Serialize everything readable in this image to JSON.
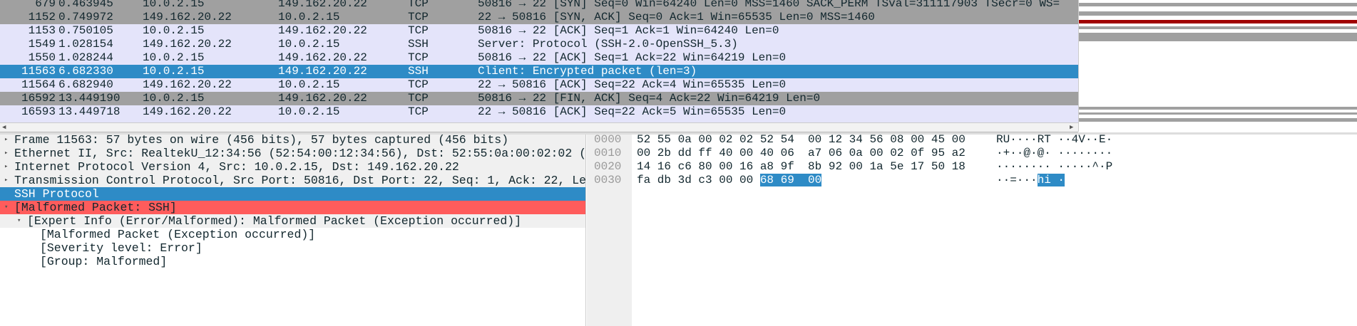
{
  "packets": [
    {
      "no": "679",
      "time": "0.463945",
      "src": "10.0.2.15",
      "dst": "149.162.20.22",
      "proto": "TCP",
      "info": "50816 → 22 [SYN] Seq=0 Win=64240 Len=0 MSS=1460 SACK_PERM TSval=311117903 TSecr=0 WS=",
      "style": "gray"
    },
    {
      "no": "1152",
      "time": "0.749972",
      "src": "149.162.20.22",
      "dst": "10.0.2.15",
      "proto": "TCP",
      "info": "22 → 50816 [SYN, ACK] Seq=0 Ack=1 Win=65535 Len=0 MSS=1460",
      "style": "gray"
    },
    {
      "no": "1153",
      "time": "0.750105",
      "src": "10.0.2.15",
      "dst": "149.162.20.22",
      "proto": "TCP",
      "info": "50816 → 22 [ACK] Seq=1 Ack=1 Win=64240 Len=0",
      "style": "lav"
    },
    {
      "no": "1549",
      "time": "1.028154",
      "src": "149.162.20.22",
      "dst": "10.0.2.15",
      "proto": "SSH",
      "info": "Server: Protocol (SSH-2.0-OpenSSH_5.3)",
      "style": "lav"
    },
    {
      "no": "1550",
      "time": "1.028244",
      "src": "10.0.2.15",
      "dst": "149.162.20.22",
      "proto": "TCP",
      "info": "50816 → 22 [ACK] Seq=1 Ack=22 Win=64219 Len=0",
      "style": "lav"
    },
    {
      "no": "11563",
      "time": "6.682330",
      "src": "10.0.2.15",
      "dst": "149.162.20.22",
      "proto": "SSH",
      "info": "Client: Encrypted packet (len=3)",
      "style": "sel"
    },
    {
      "no": "11564",
      "time": "6.682940",
      "src": "149.162.20.22",
      "dst": "10.0.2.15",
      "proto": "TCP",
      "info": "22 → 50816 [ACK] Seq=22 Ack=4 Win=65535 Len=0",
      "style": "lav"
    },
    {
      "no": "16592",
      "time": "13.449190",
      "src": "10.0.2.15",
      "dst": "149.162.20.22",
      "proto": "TCP",
      "info": "50816 → 22 [FIN, ACK] Seq=4 Ack=22 Win=64219 Len=0",
      "style": "gray"
    },
    {
      "no": "16593",
      "time": "13.449718",
      "src": "149.162.20.22",
      "dst": "10.0.2.15",
      "proto": "TCP",
      "info": "22 → 50816 [ACK] Seq=22 Ack=5 Win=65535 Len=0",
      "style": "lav"
    }
  ],
  "details": [
    {
      "text": "Frame 11563: 57 bytes on wire (456 bits), 57 bytes captured (456 bits)",
      "indent": 0,
      "twisty": "▸",
      "style": "lg"
    },
    {
      "text": "Ethernet II, Src: RealtekU_12:34:56 (52:54:00:12:34:56), Dst: 52:55:0a:00:02:02 (",
      "indent": 0,
      "twisty": "▸",
      "style": "lg"
    },
    {
      "text": "Internet Protocol Version 4, Src: 10.0.2.15, Dst: 149.162.20.22",
      "indent": 0,
      "twisty": "▸",
      "style": "lg"
    },
    {
      "text": "Transmission Control Protocol, Src Port: 50816, Dst Port: 22, Seq: 1, Ack: 22, Le",
      "indent": 0,
      "twisty": "▸",
      "style": "lg"
    },
    {
      "text": "SSH Protocol",
      "indent": 0,
      "twisty": "",
      "style": "sel"
    },
    {
      "text": "[Malformed Packet: SSH]",
      "indent": 0,
      "twisty": "▾",
      "style": "err"
    },
    {
      "text": "[Expert Info (Error/Malformed): Malformed Packet (Exception occurred)]",
      "indent": 1,
      "twisty": "▾",
      "style": "lg"
    },
    {
      "text": "[Malformed Packet (Exception occurred)]",
      "indent": 2,
      "twisty": "",
      "style": ""
    },
    {
      "text": "[Severity level: Error]",
      "indent": 2,
      "twisty": "",
      "style": ""
    },
    {
      "text": "[Group: Malformed]",
      "indent": 2,
      "twisty": "",
      "style": ""
    }
  ],
  "hex": [
    {
      "offset": "0000",
      "bytes": "52 55 0a 00 02 02 52 54  00 12 34 56 08 00 45 00",
      "hl": "",
      "ascii": "RU····RT ··4V··E·",
      "ahl": ""
    },
    {
      "offset": "0010",
      "bytes": "00 2b dd ff 40 00 40 06  a7 06 0a 00 02 0f 95 a2",
      "hl": "",
      "ascii": "·+··@·@· ········",
      "ahl": ""
    },
    {
      "offset": "0020",
      "bytes": "14 16 c6 80 00 16 a8 9f  8b 92 00 1a 5e 17 50 18",
      "hl": "",
      "ascii": "········ ·····^·P",
      "ahl": ""
    },
    {
      "offset": "0030",
      "bytes": "fa db 3d c3 00 00 ",
      "hl": "68 69  00",
      "ascii": "··=···",
      "ahl": "hi ·"
    }
  ],
  "colors": {
    "selected": "#2e8bc6",
    "malformed": "#ff5c5c",
    "tcp_flag": "#a0a0a0",
    "tcp": "#e4e4fa"
  }
}
